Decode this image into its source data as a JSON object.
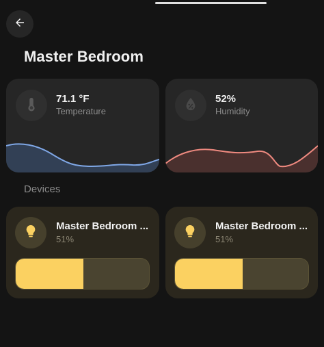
{
  "header": {
    "back_icon": "arrow-left-icon",
    "title": "Master Bedroom"
  },
  "sensors": [
    {
      "value": "71.1 °F",
      "label": "Temperature",
      "icon": "thermometer-icon",
      "color": "#7fa7e6",
      "fill": "#324055"
    },
    {
      "value": "52%",
      "label": "Humidity",
      "icon": "water-percent-icon",
      "color": "#f08a80",
      "fill": "#4a302e"
    }
  ],
  "devices_section": {
    "label": "Devices"
  },
  "devices": [
    {
      "name": "Master Bedroom ...",
      "level_text": "51%",
      "level": 0.51,
      "icon": "lightbulb-icon"
    },
    {
      "name": "Master Bedroom ...",
      "level_text": "51%",
      "level": 0.51,
      "icon": "lightbulb-icon"
    }
  ],
  "colors": {
    "background": "#141414",
    "card": "#262626",
    "light_card": "#2b271d",
    "light_accent": "#fbd161"
  }
}
